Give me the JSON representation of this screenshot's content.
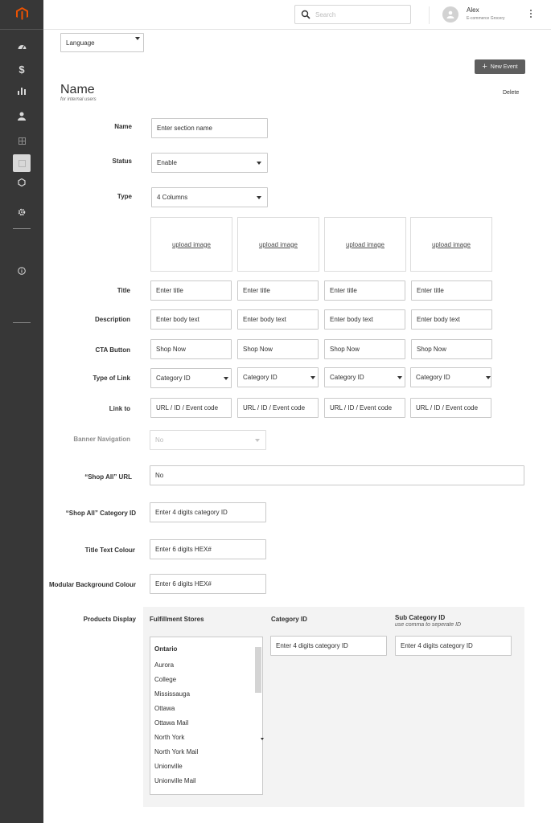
{
  "header": {
    "search_placeholder": "Search",
    "user_name": "Alex",
    "user_subtitle": "E-commerce Grocery"
  },
  "sidebar": {
    "icons": [
      "dashboard-icon",
      "dollar-icon",
      "bar-chart-icon",
      "user-icon",
      "grid-icon",
      "layout-icon",
      "hexagon-icon",
      "gear-icon",
      "info-icon"
    ],
    "active_item": "layout-icon"
  },
  "toolbar": {
    "language_label": "Language",
    "new_event_label": "New Event"
  },
  "page": {
    "title": "Name",
    "subtitle": "for internal users",
    "delete_label": "Delete"
  },
  "form": {
    "name_label": "Name",
    "name_placeholder": "Enter section name",
    "status_label": "Status",
    "status_value": "Enable",
    "type_label": "Type",
    "type_value": "4 Columns",
    "upload_label": "upload image",
    "title_label": "Title",
    "title_placeholder": "Enter title",
    "description_label": "Description",
    "description_placeholder": "Enter body text",
    "cta_label": "CTA Button",
    "cta_value": "Shop Now",
    "link_type_label": "Type of Link",
    "link_type_value": "Category ID",
    "link_to_label": "Link to",
    "link_to_placeholder": "URL / ID / Event code",
    "banner_nav_label": "Banner Navigation",
    "banner_nav_value": "No",
    "shop_all_url_label": "“Shop All” URL",
    "shop_all_url_value": "No",
    "shop_all_cat_label": "“Shop All” Category ID",
    "shop_all_cat_placeholder": "Enter 4 digits category ID",
    "title_colour_label": "Title Text Colour",
    "title_colour_placeholder": "Enter 6 digits HEX#",
    "bg_colour_label": "Modular Background Colour",
    "bg_colour_placeholder": "Enter 6 digits HEX#"
  },
  "products": {
    "label": "Products Display",
    "stores_header": "Fulfillment Stores",
    "category_header": "Category ID",
    "subcategory_header": "Sub Category ID",
    "subcategory_note": "use comma to seperate ID",
    "category_placeholder": "Enter 4 digits category ID",
    "subcategory_placeholder": "Enter 4 digits category ID",
    "stores": [
      "Ontario",
      "Aurora",
      "College",
      "Mississauga",
      "Ottawa",
      "Ottawa Mail",
      "North York",
      "North York Mail",
      "Unionville",
      "Unionville Mail"
    ]
  },
  "colors": {
    "sidebar_bg": "#373737",
    "brand_orange": "#eb5202",
    "button_bg": "#5e5e5e",
    "panel_bg": "#f3f3f3"
  }
}
